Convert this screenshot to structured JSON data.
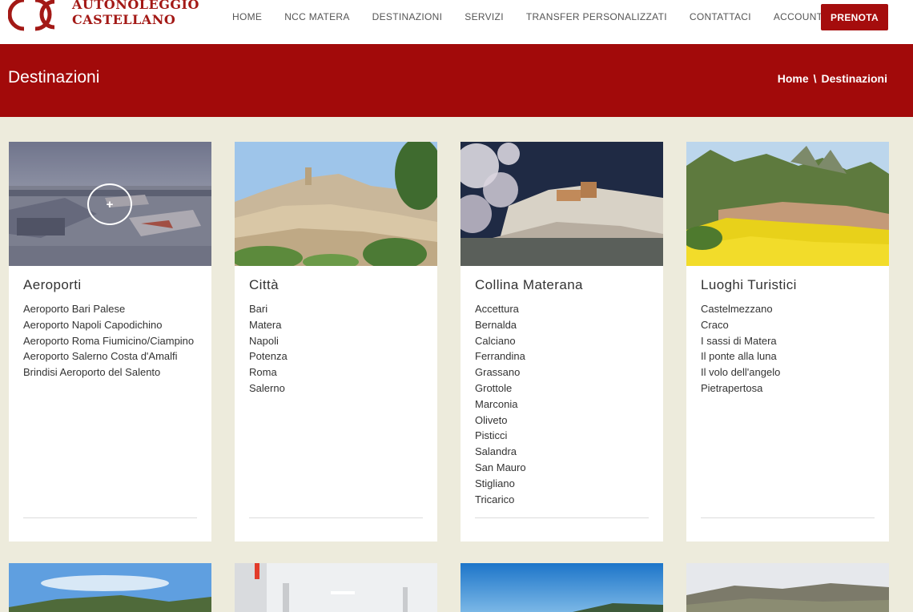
{
  "brand": {
    "line1": "AUTONOLEGGIO",
    "line2": "CASTELLANO",
    "color": "#a31916"
  },
  "nav": [
    {
      "label": "HOME"
    },
    {
      "label": "NCC MATERA"
    },
    {
      "label": "DESTINAZIONI"
    },
    {
      "label": "SERVIZI"
    },
    {
      "label": "TRANSFER PERSONALIZZATI"
    },
    {
      "label": "CONTATTACI"
    },
    {
      "label": "ACCOUNT"
    }
  ],
  "cta": {
    "label": "PRENOTA",
    "color": "#a50d0d"
  },
  "banner": {
    "title": "Destinazioni",
    "breadcrumb": {
      "home": "Home",
      "separator": "\\",
      "current": "Destinazioni"
    },
    "color": "#a20a0a"
  },
  "cards": [
    {
      "title": "Aeroporti",
      "items": [
        "Aeroporto Bari Palese",
        "Aeroporto Napoli Capodichino",
        "Aeroporto Roma Fiumicino/Ciampino",
        "Aeroporto Salerno Costa d'Amalfi",
        "Brindisi Aeroporto del Salento"
      ],
      "overlay_icon": "plus-icon",
      "overlay_symbol": "+"
    },
    {
      "title": "Città",
      "items": [
        "Bari",
        "Matera",
        "Napoli",
        "Potenza",
        "Roma",
        "Salerno"
      ]
    },
    {
      "title": "Collina Materana",
      "items": [
        "Accettura",
        "Bernalda",
        "Calciano",
        "Ferrandina",
        "Grassano",
        "Grottole",
        "Marconia",
        "Oliveto",
        "Pisticci",
        "Salandra",
        "San Mauro",
        "Stigliano",
        "Tricarico"
      ]
    },
    {
      "title": "Luoghi Turistici",
      "items": [
        "Castelmezzano",
        "Craco",
        "I sassi di Matera",
        "Il ponte alla luna",
        "Il volo dell'angelo",
        "Pietrapertosa"
      ]
    }
  ]
}
